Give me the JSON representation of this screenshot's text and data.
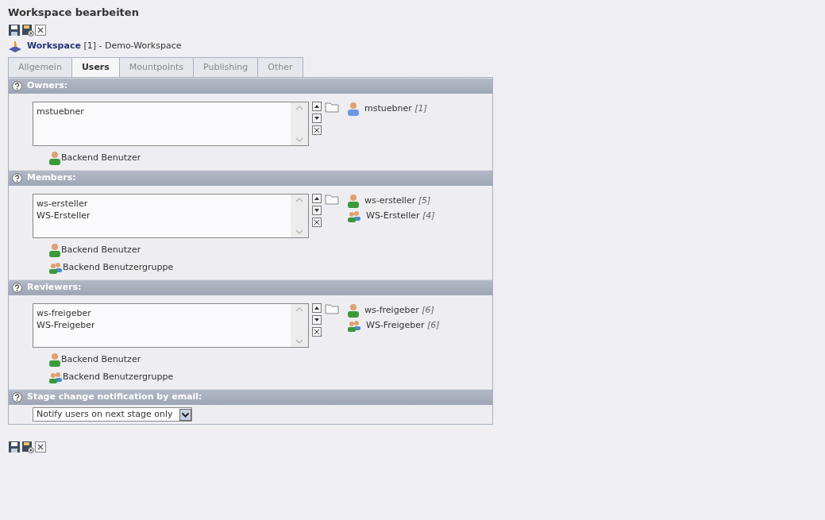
{
  "page": {
    "title": "Workspace bearbeiten"
  },
  "record": {
    "type": "Workspace",
    "id": "[1]",
    "name": "- Demo-Workspace"
  },
  "tabs": [
    {
      "label": "Allgemein",
      "selected": false
    },
    {
      "label": "Users",
      "selected": true
    },
    {
      "label": "Mountpoints",
      "selected": false
    },
    {
      "label": "Publishing",
      "selected": false
    },
    {
      "label": "Other",
      "selected": false
    }
  ],
  "sections": [
    {
      "kind": "relation",
      "label": "Owners:",
      "list": [
        "mstuebner"
      ],
      "related": [
        {
          "kind": "admin",
          "name": "mstuebner",
          "id": "[1]"
        }
      ],
      "add_links": [
        {
          "kind": "user",
          "label": "Backend Benutzer"
        }
      ]
    },
    {
      "kind": "relation",
      "label": "Members:",
      "list": [
        "ws-ersteller",
        "WS-Ersteller"
      ],
      "related": [
        {
          "kind": "user",
          "name": "ws-ersteller",
          "id": "[5]"
        },
        {
          "kind": "group",
          "name": "WS-Ersteller",
          "id": "[4]"
        }
      ],
      "add_links": [
        {
          "kind": "user",
          "label": "Backend Benutzer"
        },
        {
          "kind": "group",
          "label": "Backend Benutzergruppe"
        }
      ]
    },
    {
      "kind": "relation",
      "label": "Reviewers:",
      "list": [
        "ws-freigeber",
        "WS-Freigeber"
      ],
      "related": [
        {
          "kind": "user",
          "name": "ws-freigeber",
          "id": "[6]"
        },
        {
          "kind": "group",
          "name": "WS-Freigeber",
          "id": "[6]"
        }
      ],
      "add_links": [
        {
          "kind": "user",
          "label": "Backend Benutzer"
        },
        {
          "kind": "group",
          "label": "Backend Benutzergruppe"
        }
      ]
    },
    {
      "kind": "select",
      "label": "Stage change notification by email:",
      "value": "Notify users on next stage only"
    }
  ]
}
